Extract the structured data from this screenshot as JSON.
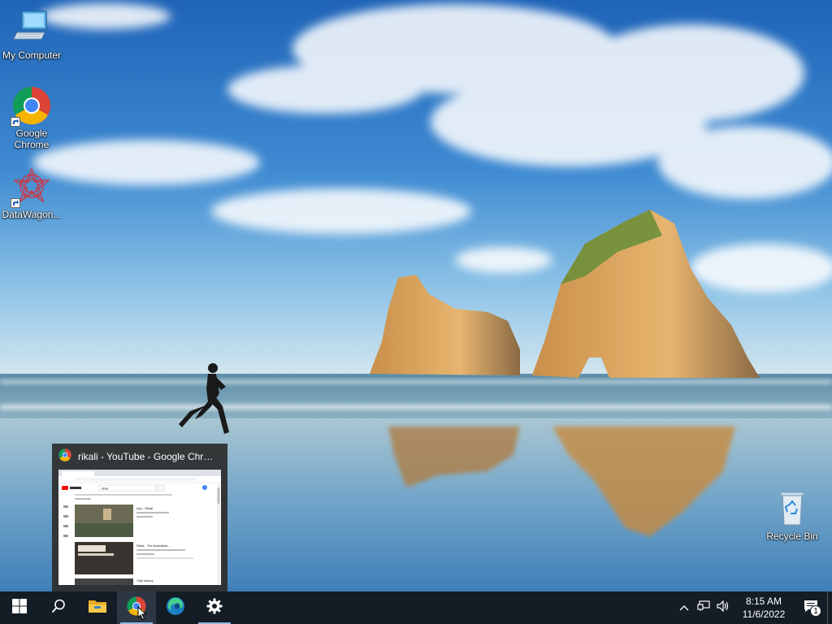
{
  "desktop": {
    "icons": [
      {
        "label": "My Computer",
        "icon": "computer-icon"
      },
      {
        "label": "Google Chrome",
        "icon": "chrome-icon"
      },
      {
        "label": "DataWagon...",
        "icon": "datawagon-icon"
      },
      {
        "label": "Recycle Bin",
        "icon": "recycle-bin-icon"
      }
    ]
  },
  "preview": {
    "window_title": "rikali - YouTube - Google Chro...",
    "thumbnail": {
      "search_term": "rikali",
      "results": [
        {
          "title": "Ayo - Rikali"
        },
        {
          "title": "Raka - The Australian..."
        },
        {
          "title": "Ytali history"
        }
      ]
    }
  },
  "taskbar": {
    "buttons": [
      {
        "name": "start-button",
        "icon": "windows-logo-icon"
      },
      {
        "name": "search-button",
        "icon": "search-icon"
      },
      {
        "name": "file-explorer-button",
        "icon": "folder-icon"
      },
      {
        "name": "chrome-button",
        "icon": "chrome-icon"
      },
      {
        "name": "edge-button",
        "icon": "edge-icon"
      },
      {
        "name": "settings-button",
        "icon": "gear-icon"
      }
    ],
    "clock": {
      "time": "8:15 AM",
      "date": "11/6/2022"
    },
    "notification_count": "1"
  },
  "colors": {
    "taskbar": "#141c25",
    "accent": "#8fb6e0"
  }
}
